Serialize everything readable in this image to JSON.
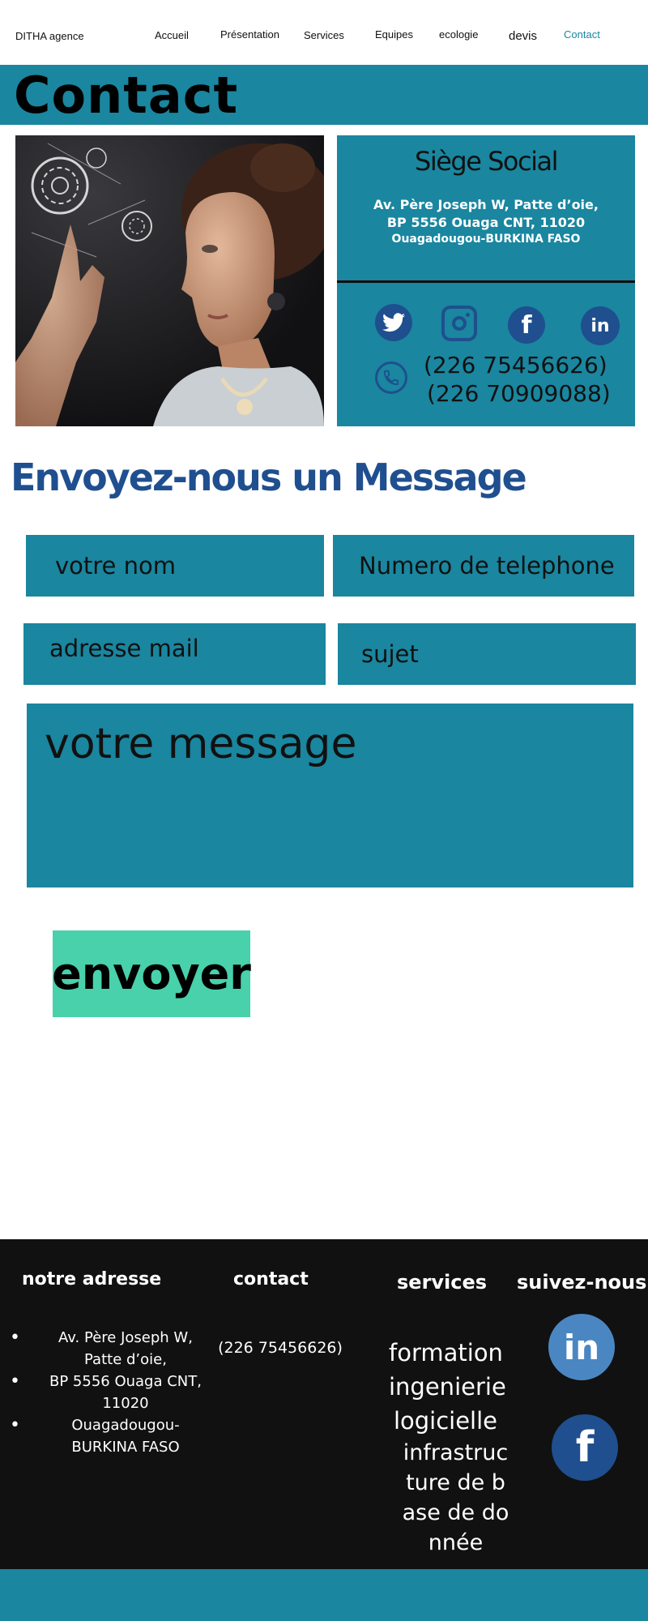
{
  "nav": {
    "brand": "DITHA agence",
    "items": [
      {
        "label": "Accueil"
      },
      {
        "label": "Présentation"
      },
      {
        "label": "Services"
      },
      {
        "label": "Equipes"
      },
      {
        "label": "ecologie"
      },
      {
        "label": "devis"
      },
      {
        "label": "Contact"
      }
    ],
    "active_color": "#1a869f"
  },
  "page": {
    "title": "Contact",
    "accent": "#1a869f",
    "heading_color": "#1f4f8f"
  },
  "siege": {
    "title": "Siège Social",
    "address_line1": "Av. Père Joseph W, Patte d’oie,",
    "address_line2": "BP 5556 Ouaga CNT, 11020",
    "address_line3": "Ouagadougou-BURKINA FASO",
    "socials": [
      "twitter-icon",
      "instagram-icon",
      "facebook-icon",
      "linkedin-icon"
    ],
    "phone1": "(226 75456626)",
    "phone2": "(226 70909088)"
  },
  "message": {
    "heading": "Envoyez-nous un Message",
    "name_placeholder": "votre nom",
    "phone_placeholder": "Numero de telephone",
    "email_placeholder": "adresse mail",
    "subject_placeholder": "sujet",
    "message_placeholder": "votre message",
    "submit_label": "envoyer",
    "submit_color": "#48d1ab"
  },
  "footer": {
    "address_heading": "notre adresse",
    "address_items": [
      "Av. Père Joseph W, Patte d’oie,",
      "BP 5556 Ouaga CNT, 11020",
      "Ouagadougou-BURKINA FASO"
    ],
    "contact_heading": "contact",
    "contact_phone": "(226 75456626)",
    "services_heading": "services",
    "services_item1": "formation ingenierie logicielle",
    "services_item2": "infrastructure de base de donnée",
    "follow_heading": "suivez-nous",
    "bg_color": "#111111"
  }
}
